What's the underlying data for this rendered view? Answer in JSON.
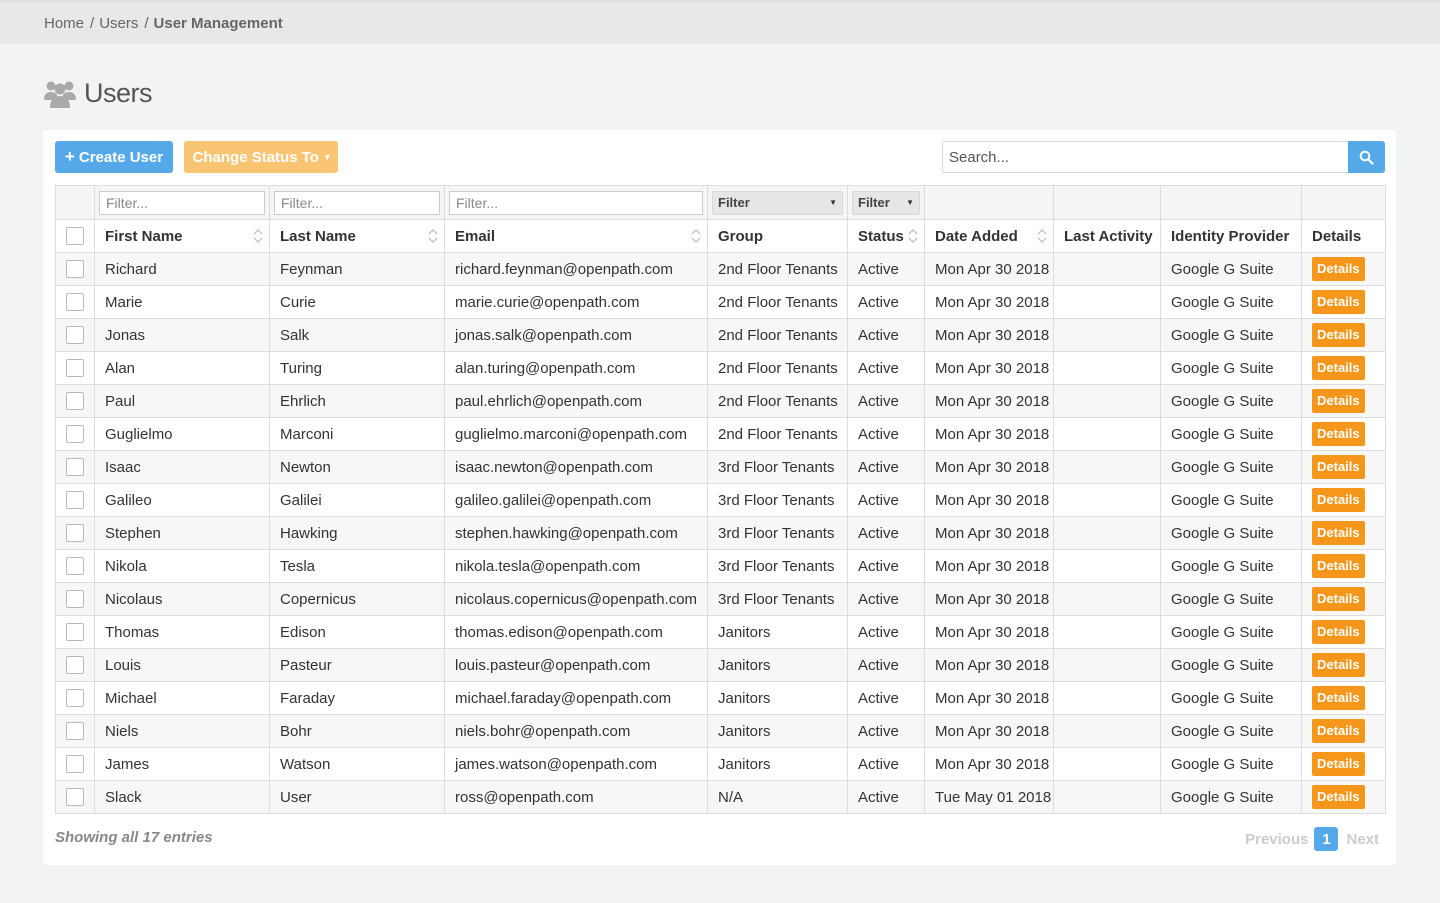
{
  "breadcrumb": {
    "home": "Home",
    "sep1": "/",
    "users": "Users",
    "sep2": "/",
    "current": "User Management"
  },
  "page": {
    "title": "Users",
    "icon": "users-group-icon"
  },
  "toolbar": {
    "create_label": "Create User",
    "create_icon": "+",
    "status_label": "Change Status To",
    "status_caret": "▾",
    "search_placeholder": "Search...",
    "search_icon": "search-icon"
  },
  "filters": {
    "first_name_placeholder": "Filter...",
    "last_name_placeholder": "Filter...",
    "email_placeholder": "Filter...",
    "group_label": "Filter",
    "status_label": "Filter"
  },
  "columns": {
    "first_name": "First Name",
    "last_name": "Last Name",
    "email": "Email",
    "group": "Group",
    "status": "Status",
    "date_added": "Date Added",
    "last_activity": "Last Activity",
    "identity_provider": "Identity Provider",
    "details": "Details"
  },
  "details_label": "Details",
  "rows": [
    {
      "first": "Richard",
      "last": "Feynman",
      "email": "richard.feynman@openpath.com",
      "group": "2nd Floor Tenants",
      "status": "Active",
      "date": "Mon Apr 30 2018",
      "activity": "",
      "idp": "Google G Suite"
    },
    {
      "first": "Marie",
      "last": "Curie",
      "email": "marie.curie@openpath.com",
      "group": "2nd Floor Tenants",
      "status": "Active",
      "date": "Mon Apr 30 2018",
      "activity": "",
      "idp": "Google G Suite"
    },
    {
      "first": "Jonas",
      "last": "Salk",
      "email": "jonas.salk@openpath.com",
      "group": "2nd Floor Tenants",
      "status": "Active",
      "date": "Mon Apr 30 2018",
      "activity": "",
      "idp": "Google G Suite"
    },
    {
      "first": "Alan",
      "last": "Turing",
      "email": "alan.turing@openpath.com",
      "group": "2nd Floor Tenants",
      "status": "Active",
      "date": "Mon Apr 30 2018",
      "activity": "",
      "idp": "Google G Suite"
    },
    {
      "first": "Paul",
      "last": "Ehrlich",
      "email": "paul.ehrlich@openpath.com",
      "group": "2nd Floor Tenants",
      "status": "Active",
      "date": "Mon Apr 30 2018",
      "activity": "",
      "idp": "Google G Suite"
    },
    {
      "first": "Guglielmo",
      "last": "Marconi",
      "email": "guglielmo.marconi@openpath.com",
      "group": "2nd Floor Tenants",
      "status": "Active",
      "date": "Mon Apr 30 2018",
      "activity": "",
      "idp": "Google G Suite"
    },
    {
      "first": "Isaac",
      "last": "Newton",
      "email": "isaac.newton@openpath.com",
      "group": "3rd Floor Tenants",
      "status": "Active",
      "date": "Mon Apr 30 2018",
      "activity": "",
      "idp": "Google G Suite"
    },
    {
      "first": "Galileo",
      "last": "Galilei",
      "email": "galileo.galilei@openpath.com",
      "group": "3rd Floor Tenants",
      "status": "Active",
      "date": "Mon Apr 30 2018",
      "activity": "",
      "idp": "Google G Suite"
    },
    {
      "first": "Stephen",
      "last": "Hawking",
      "email": "stephen.hawking@openpath.com",
      "group": "3rd Floor Tenants",
      "status": "Active",
      "date": "Mon Apr 30 2018",
      "activity": "",
      "idp": "Google G Suite"
    },
    {
      "first": "Nikola",
      "last": "Tesla",
      "email": "nikola.tesla@openpath.com",
      "group": "3rd Floor Tenants",
      "status": "Active",
      "date": "Mon Apr 30 2018",
      "activity": "",
      "idp": "Google G Suite"
    },
    {
      "first": "Nicolaus",
      "last": "Copernicus",
      "email": "nicolaus.copernicus@openpath.com",
      "group": "3rd Floor Tenants",
      "status": "Active",
      "date": "Mon Apr 30 2018",
      "activity": "",
      "idp": "Google G Suite"
    },
    {
      "first": "Thomas",
      "last": "Edison",
      "email": "thomas.edison@openpath.com",
      "group": "Janitors",
      "status": "Active",
      "date": "Mon Apr 30 2018",
      "activity": "",
      "idp": "Google G Suite"
    },
    {
      "first": "Louis",
      "last": "Pasteur",
      "email": "louis.pasteur@openpath.com",
      "group": "Janitors",
      "status": "Active",
      "date": "Mon Apr 30 2018",
      "activity": "",
      "idp": "Google G Suite"
    },
    {
      "first": "Michael",
      "last": "Faraday",
      "email": "michael.faraday@openpath.com",
      "group": "Janitors",
      "status": "Active",
      "date": "Mon Apr 30 2018",
      "activity": "",
      "idp": "Google G Suite"
    },
    {
      "first": "Niels",
      "last": "Bohr",
      "email": "niels.bohr@openpath.com",
      "group": "Janitors",
      "status": "Active",
      "date": "Mon Apr 30 2018",
      "activity": "",
      "idp": "Google G Suite"
    },
    {
      "first": "James",
      "last": "Watson",
      "email": "james.watson@openpath.com",
      "group": "Janitors",
      "status": "Active",
      "date": "Mon Apr 30 2018",
      "activity": "",
      "idp": "Google G Suite"
    },
    {
      "first": "Slack",
      "last": "User",
      "email": "ross@openpath.com",
      "group": "N/A",
      "status": "Active",
      "date": "Tue May 01 2018",
      "activity": "",
      "idp": "Google G Suite"
    }
  ],
  "footer": {
    "summary": "Showing all 17 entries",
    "prev": "Previous",
    "page": "1",
    "next": "Next"
  },
  "colors": {
    "primary": "#56a9e8",
    "warning_light": "#f9c572",
    "details": "#f6961b"
  }
}
